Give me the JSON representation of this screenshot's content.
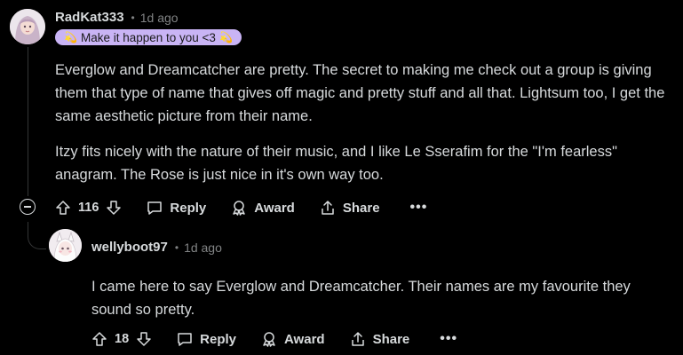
{
  "comment": {
    "username": "RadKat333",
    "separator": "•",
    "timestamp": "1d ago",
    "flair": {
      "emoji": "💫",
      "text": "Make it happen to you <3",
      "color": "#c9b4f5"
    },
    "paragraphs": [
      "Everglow and Dreamcatcher are pretty. The secret to making me check out a group is giving them that type of name that gives off magic and pretty stuff and all that. Lightsum too, I get the same aesthetic picture from their name.",
      "Itzy fits nicely with the nature of their music, and I like Le Sserafim for the \"I'm fearless\" anagram. The Rose is just nice in it's own way too."
    ],
    "votes": "116",
    "actions": {
      "reply": "Reply",
      "award": "Award",
      "share": "Share",
      "more": "•••"
    }
  },
  "reply": {
    "username": "wellyboot97",
    "separator": "•",
    "timestamp": "1d ago",
    "body": "I came here to say Everglow and Dreamcatcher. Their names are my favourite they sound so pretty.",
    "votes": "18",
    "actions": {
      "reply": "Reply",
      "award": "Award",
      "share": "Share",
      "more": "•••"
    }
  },
  "theme": {
    "background": "#000000",
    "text": "#d7dadc",
    "muted": "#818384",
    "thread_line": "#343536"
  }
}
